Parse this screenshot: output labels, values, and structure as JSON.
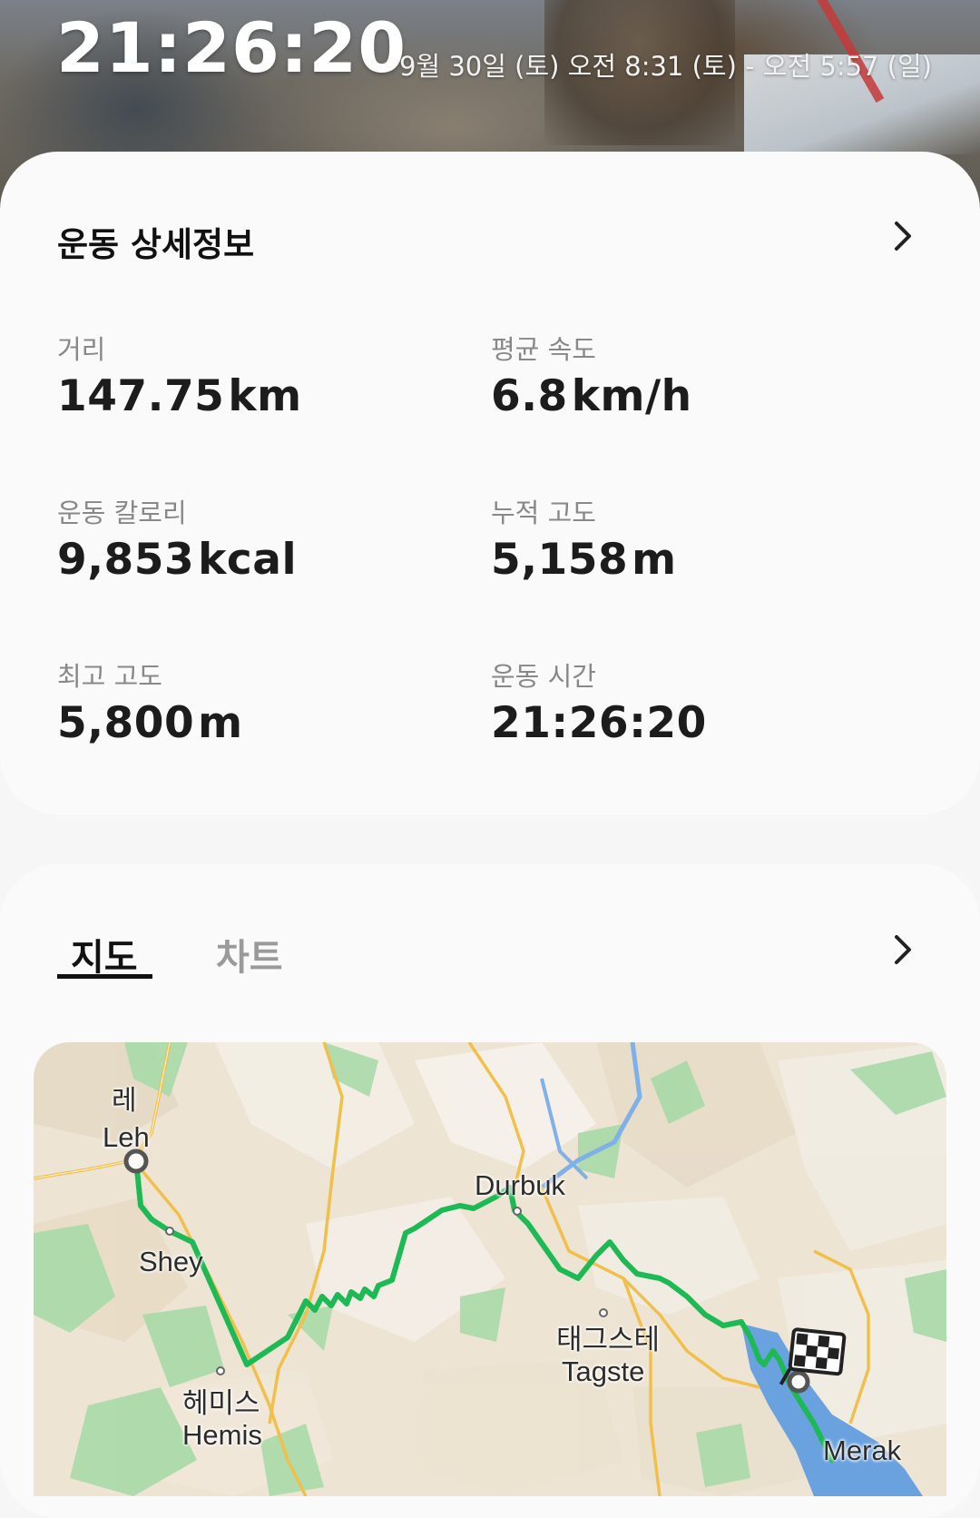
{
  "header": {
    "duration": "21:26:20",
    "date_range": "9월 30일 (토) 오전 8:31 (토) - 오전 5:57 (일)"
  },
  "details": {
    "title": "운동 상세정보",
    "chevron_icon": "chevron-right-icon",
    "stats": [
      {
        "label": "거리",
        "value": "147.75",
        "unit": "km"
      },
      {
        "label": "평균 속도",
        "value": "6.8",
        "unit": "km/h"
      },
      {
        "label": "운동 칼로리",
        "value": "9,853",
        "unit": "kcal"
      },
      {
        "label": "누적 고도",
        "value": "5,158",
        "unit": "m"
      },
      {
        "label": "최고 고도",
        "value": "5,800",
        "unit": "m"
      },
      {
        "label": "운동 시간",
        "value": "21:26:20",
        "unit": ""
      }
    ]
  },
  "map_section": {
    "tabs": [
      {
        "label": "지도",
        "active": true
      },
      {
        "label": "차트",
        "active": false
      }
    ],
    "route_color": "#1db954",
    "places": {
      "leh_ko": "레",
      "leh_en": "Leh",
      "shey": "Shey",
      "hemis_ko": "헤미스",
      "hemis_en": "Hemis",
      "durbuk": "Durbuk",
      "tagste_ko": "태그스테",
      "tagste_en": "Tagste",
      "merak": "Merak"
    }
  }
}
